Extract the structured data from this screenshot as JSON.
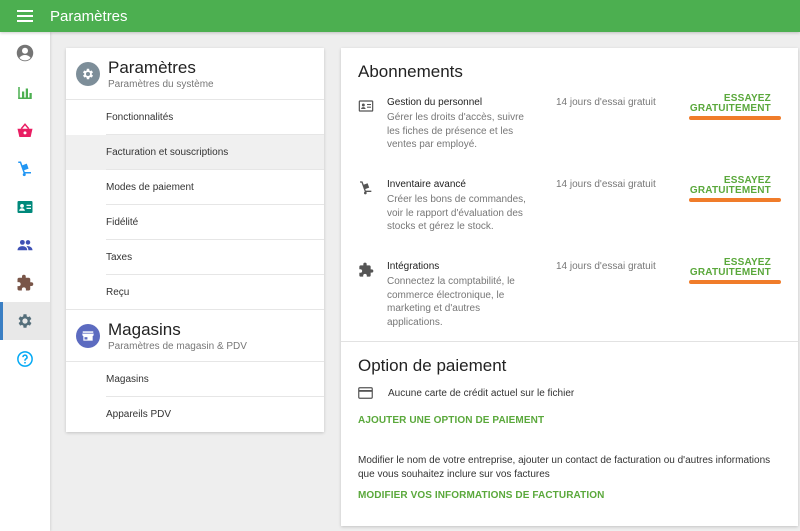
{
  "topbar": {
    "title": "Paramètres",
    "menu_icon": "hamburger-menu-icon"
  },
  "leftnav": {
    "items": [
      {
        "icon": "account-circle-icon",
        "color": "#757575"
      },
      {
        "icon": "bar-chart-icon",
        "color": "#4caf50"
      },
      {
        "icon": "basket-icon",
        "color": "#e91e63"
      },
      {
        "icon": "hand-truck-icon",
        "color": "#2196f3"
      },
      {
        "icon": "contact-card-icon",
        "color": "#00897b"
      },
      {
        "icon": "people-icon",
        "color": "#3f51b5"
      },
      {
        "icon": "puzzle-icon",
        "color": "#795548"
      },
      {
        "icon": "gear-icon",
        "color": "#546e7a",
        "active": true
      },
      {
        "icon": "help-circle-icon",
        "color": "#03a9f4"
      }
    ]
  },
  "settings": {
    "title": "Paramètres",
    "subtitle": "Paramètres du système",
    "items": [
      "Fonctionnalités",
      "Facturation et souscriptions",
      "Modes de paiement",
      "Fidélité",
      "Taxes",
      "Reçu"
    ],
    "selected_index": 1
  },
  "stores": {
    "title": "Magasins",
    "subtitle": "Paramètres de magasin & PDV",
    "items": [
      "Magasins",
      "Appareils PDV"
    ]
  },
  "subscriptions": {
    "title": "Abonnements",
    "rows": [
      {
        "icon": "id-card-icon",
        "name": "Gestion du personnel",
        "description": "Gérer les droits d'accès, suivre les fiches de présence et les ventes par employé.",
        "trial": "14 jours d'essai gratuit",
        "cta_line1": "ESSAYEZ",
        "cta_line2": "GRATUITEMENT"
      },
      {
        "icon": "hand-truck-icon",
        "name": "Inventaire avancé",
        "description": "Créer les bons de commandes, voir le rapport d'évaluation des stocks et gérez le stock.",
        "trial": "14 jours d'essai gratuit",
        "cta_line1": "ESSAYEZ",
        "cta_line2": "GRATUITEMENT"
      },
      {
        "icon": "puzzle-icon",
        "name": "Intégrations",
        "description": "Connectez la comptabilité, le commerce électronique, le marketing et d'autres applications.",
        "trial": "14 jours d'essai gratuit",
        "cta_line1": "ESSAYEZ",
        "cta_line2": "GRATUITEMENT"
      }
    ]
  },
  "payment": {
    "title": "Option de paiement",
    "card_status": "Aucune carte de crédit actuel sur le fichier",
    "add_option": "AJOUTER UNE OPTION DE PAIEMENT",
    "note": "Modifier le nom de votre entreprise, ajouter un contact de facturation ou d'autres informations que vous souhaitez inclure sur vos factures",
    "edit_billing": "MODIFIER VOS INFORMATIONS DE FACTURATION"
  },
  "colors": {
    "topbar": "#4caf50",
    "accent_green": "#5aa83b",
    "highlight_orange": "#f07c2a",
    "active_nav_bar": "#3b7fc4"
  }
}
